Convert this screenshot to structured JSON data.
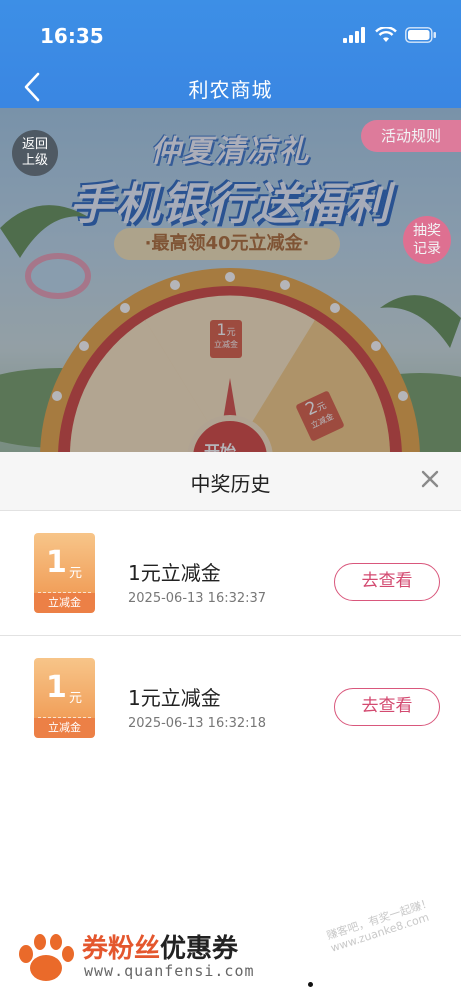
{
  "status_bar": {
    "time": "16:35"
  },
  "nav": {
    "title": "利农商城"
  },
  "banner": {
    "back_label": "返回上级",
    "rules_label": "活动规则",
    "record_label": "抽奖记录",
    "title_line1": "仲夏清凉礼",
    "title_line2": "手机银行送福利",
    "subtitle": "·最高领40元立减金·",
    "wheel_prizes": [
      {
        "amount": "1",
        "unit": "元",
        "caption": "立减金"
      },
      {
        "amount": "2",
        "unit": "元",
        "caption": "立减金"
      }
    ],
    "wheel_center": "开始"
  },
  "history": {
    "title": "中奖历史",
    "items": [
      {
        "coupon_amount": "1",
        "coupon_unit": "元",
        "coupon_caption": "立减金",
        "name": "1元立减金",
        "time": "2025-06-13 16:32:37",
        "action": "去查看"
      },
      {
        "coupon_amount": "1",
        "coupon_unit": "元",
        "coupon_caption": "立减金",
        "name": "1元立减金",
        "time": "2025-06-13 16:32:18",
        "action": "去查看"
      }
    ]
  },
  "watermark": {
    "brand_part1": "券粉丝",
    "brand_part2": "优惠券",
    "url": "www.quanfensi.com",
    "diag_text": "赚客吧，有奖一起赚！www.zuanke8.com"
  },
  "colors": {
    "nav_blue": "#3a86e2",
    "action_pink": "#d34a70",
    "coupon_orange": "#f19f5a"
  }
}
